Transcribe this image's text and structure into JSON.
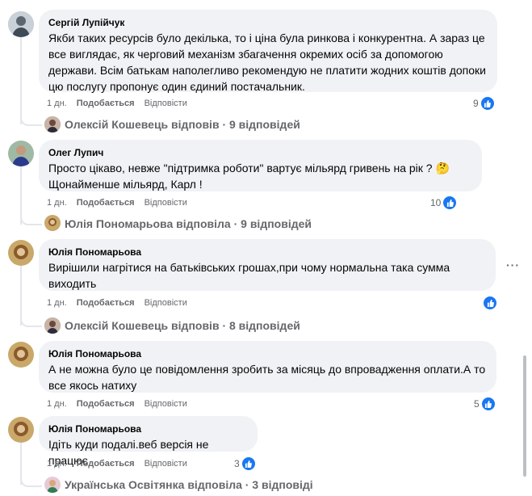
{
  "comments": [
    {
      "author": "Сергій Лупійчук",
      "text": "Якби таких ресурсів було декілька, то і ціна була ринкова і конкурентна. А зараз це все виглядає, як черговий механізм збагачення окремих осіб за допомогою держави. Всім батькам наполегливо рекомендую не платити жодних коштів допоки цю послугу пропонує один єдиний постачальник.",
      "time": "1 дн.",
      "like_label": "Подобається",
      "reply_label": "Відповісти",
      "reaction_count": "9",
      "reply_summary": "Олексій Кошевець відповів · 9 відповідей"
    },
    {
      "author": "Олег Лупич",
      "text_line1": "Просто цікаво, невже \"підтримка роботи\" вартує мільярд гривень на рік ? 🤔",
      "text_line2": "Щонайменше мільярд, Карл !",
      "time": "1 дн.",
      "like_label": "Подобається",
      "reply_label": "Відповісти",
      "reaction_count": "10",
      "reply_summary": "Юлія Пономарьова відповіла · 9 відповідей"
    },
    {
      "author": "Юлія Пономарьова",
      "text": "Вирішили нагрітися на батьківських грошах,при чому нормальна така сумма виходить",
      "time": "1 дн.",
      "like_label": "Подобається",
      "reply_label": "Відповісти",
      "reaction_count": "",
      "reply_summary": "Олексій Кошевець відповів · 8 відповідей",
      "more_label": "···"
    },
    {
      "author": "Юлія Пономарьова",
      "text": "А не можна було це повідомлення зробить за місяць до впровадження оплати.А то все якось натиху",
      "time": "1 дн.",
      "like_label": "Подобається",
      "reply_label": "Відповісти",
      "reaction_count": "5"
    },
    {
      "author": "Юлія Пономарьова",
      "text": "Ідіть куди подалі.веб версія не працює",
      "time": "1 дн.",
      "like_label": "Подобається",
      "reply_label": "Відповісти",
      "reaction_count": "3",
      "reply_summary": "Українська Освітянка відповіла · 3 відповіді"
    }
  ],
  "colors": {
    "like_blue": "#1877f2",
    "bubble_bg": "#f0f2f5",
    "meta_gray": "#65676b"
  },
  "icons": {
    "reaction": "like-icon",
    "menu": "more-options-icon"
  }
}
